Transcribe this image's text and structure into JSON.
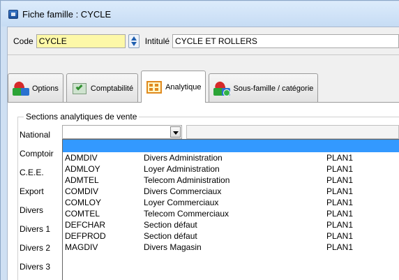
{
  "window": {
    "title": "Fiche famille : CYCLE"
  },
  "header": {
    "code_label": "Code",
    "code_value": "CYCLE",
    "intitule_label": "Intitulé",
    "intitule_value": "CYCLE ET ROLLERS"
  },
  "tabs": [
    {
      "label": "Options",
      "icon": "options-icon"
    },
    {
      "label": "Comptabilité",
      "icon": "accounting-icon"
    },
    {
      "label": "Analytique",
      "icon": "analytics-icon",
      "active": true
    },
    {
      "label": "Sous-famille / catégorie",
      "icon": "subfamily-icon"
    }
  ],
  "section": {
    "legend": "Sections analytiques de vente",
    "rows": [
      "National",
      "Comptoir",
      "C.E.E.",
      "Export",
      "Divers",
      "Divers 1",
      "Divers 2",
      "Divers 3"
    ],
    "national_value": ""
  },
  "dropdown": {
    "items": [
      {
        "code": "ADMDIV",
        "label": "Divers Administration",
        "plan": "PLAN1"
      },
      {
        "code": "ADMLOY",
        "label": "Loyer Administration",
        "plan": "PLAN1"
      },
      {
        "code": "ADMTEL",
        "label": "Telecom Administration",
        "plan": "PLAN1"
      },
      {
        "code": "COMDIV",
        "label": "Divers Commerciaux",
        "plan": "PLAN1"
      },
      {
        "code": "COMLOY",
        "label": "Loyer Commerciaux",
        "plan": "PLAN1"
      },
      {
        "code": "COMTEL",
        "label": "Telecom Commerciaux",
        "plan": "PLAN1"
      },
      {
        "code": "DEFCHAR",
        "label": "Section défaut",
        "plan": "PLAN1"
      },
      {
        "code": "DEFPROD",
        "label": "Section défaut",
        "plan": "PLAN1"
      },
      {
        "code": "MAGDIV",
        "label": "Divers Magasin",
        "plan": "PLAN1"
      }
    ]
  },
  "colors": {
    "code_bg": "#fdf8a8",
    "selection": "#3399ff",
    "window_frame": "#cfe0f3"
  }
}
